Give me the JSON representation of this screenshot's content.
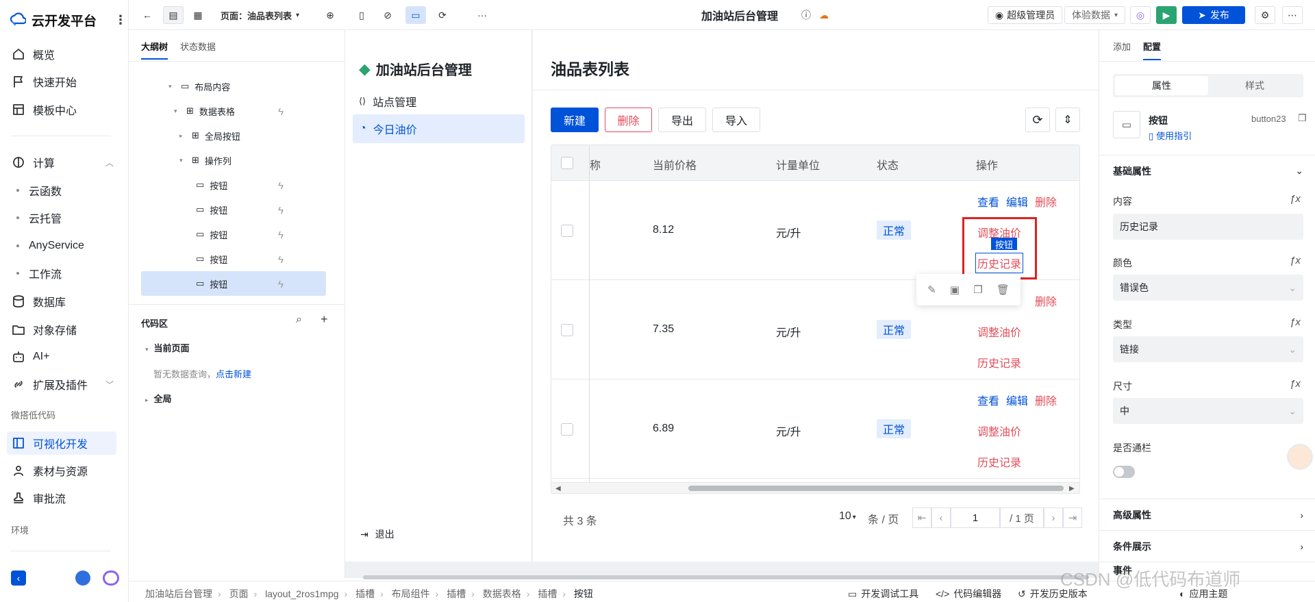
{
  "brand": {
    "title": "云开发平台"
  },
  "nav": {
    "overview": "概览",
    "quickstart": "快速开始",
    "templates": "模板中心",
    "compute": "计算",
    "cloudfunc": "云函数",
    "cloudrun": "云托管",
    "anyservice": "AnyService",
    "workflow": "工作流",
    "database": "数据库",
    "storage": "对象存储",
    "ai": "AI+",
    "extensions": "扩展及插件",
    "group_lowcode": "微搭低代码",
    "visual_dev": "可视化开发",
    "materials": "素材与资源",
    "approval": "审批流",
    "group_env": "环境"
  },
  "topbar": {
    "page_label": "页面：油品表列表",
    "app_title": "加油站后台管理",
    "user": "超级管理员",
    "data_mode": "体验数据",
    "publish": "发布"
  },
  "outline": {
    "tab_tree": "大纲树",
    "tab_state": "状态数据",
    "nodes": {
      "layout_content": "布局内容",
      "data_table": "数据表格",
      "global_buttons": "全局按钮",
      "action_column": "操作列",
      "btn1": "按钮",
      "btn2": "按钮",
      "btn3": "按钮",
      "btn4": "按钮",
      "btn5": "按钮"
    },
    "code_area": "代码区",
    "current_page": "当前页面",
    "no_query": "暂无数据查询，",
    "create_new": "点击新建",
    "global": "全局"
  },
  "app": {
    "title": "加油站后台管理",
    "menu": [
      "站点管理",
      "今日油价"
    ],
    "logout": "退出",
    "page_heading": "油品表列表",
    "buttons": {
      "new": "新建",
      "delete": "删除",
      "export": "导出",
      "import": "导入"
    }
  },
  "table": {
    "headers": {
      "name_tail": "称",
      "price": "当前价格",
      "unit": "计量单位",
      "status": "状态",
      "actions": "操作"
    },
    "rows": [
      {
        "price": "8.12",
        "unit": "元/升",
        "status": "正常"
      },
      {
        "price": "7.35",
        "unit": "元/升",
        "status": "正常"
      },
      {
        "price": "6.89",
        "unit": "元/升",
        "status": "正常"
      }
    ],
    "actions": {
      "view": "查看",
      "edit": "编辑",
      "delete": "删除",
      "adjust": "调整油价",
      "history": "历史记录"
    },
    "selected_tag": "按钮"
  },
  "pagination": {
    "total": "共 3 条",
    "page_size": "10",
    "per_page": "条 / 页",
    "current_page": "1",
    "total_pages": "/ 1 页"
  },
  "right_panel": {
    "tab_add": "添加",
    "tab_config": "配置",
    "seg_props": "属性",
    "seg_style": "样式",
    "component_name": "按钮",
    "component_id": "button23",
    "usage_guide": "使用指引",
    "section_basic": "基础属性",
    "label_content": "内容",
    "value_content": "历史记录",
    "label_color": "颜色",
    "value_color": "错误色",
    "label_type": "类型",
    "value_type": "链接",
    "label_size": "尺寸",
    "value_size": "中",
    "label_block": "是否通栏",
    "section_advanced": "高级属性",
    "section_condition": "条件展示",
    "section_event": "事件"
  },
  "bottombar": {
    "breadcrumb": [
      "加油站后台管理",
      "页面",
      "layout_2ros1mpg",
      "插槽",
      "布局组件",
      "插槽",
      "数据表格",
      "插槽",
      "按钮"
    ],
    "debug_tools": "开发调试工具",
    "code_editor": "代码编辑器",
    "history": "开发历史版本",
    "apply_theme": "应用主题"
  },
  "watermark": "CSDN @低代码布道师",
  "colors": {
    "primary": "#0052d9",
    "danger": "#e34d59",
    "publish_green": "#2ba471",
    "selection_red": "#e02020"
  }
}
